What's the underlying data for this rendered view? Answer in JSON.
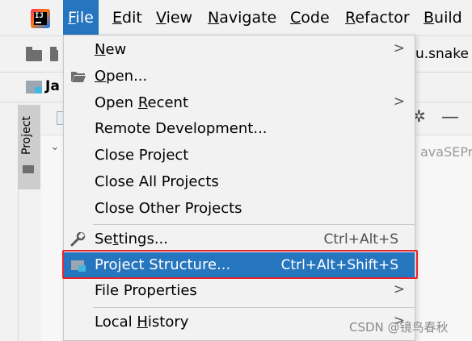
{
  "menubar": {
    "items": [
      {
        "pre": "",
        "mn": "F",
        "post": "ile"
      },
      {
        "pre": "",
        "mn": "E",
        "post": "dit"
      },
      {
        "pre": "",
        "mn": "V",
        "post": "iew"
      },
      {
        "pre": "",
        "mn": "N",
        "post": "avigate"
      },
      {
        "pre": "",
        "mn": "C",
        "post": "ode"
      },
      {
        "pre": "",
        "mn": "R",
        "post": "efactor"
      },
      {
        "pre": "",
        "mn": "B",
        "post": "uild"
      }
    ]
  },
  "toolbar": {
    "trailing_text": "u.snake"
  },
  "breadcrumb": {
    "text": "Ja"
  },
  "sidebar": {
    "project_tab": "Project"
  },
  "background": {
    "tree_text": "avaSEPr"
  },
  "file_menu": {
    "items": [
      {
        "pre": "",
        "mn": "N",
        "post": "ew",
        "arrow": ">"
      },
      {
        "pre": "",
        "mn": "O",
        "post": "pen..."
      },
      {
        "pre": "Open ",
        "mn": "R",
        "post": "ecent",
        "arrow": ">"
      },
      {
        "label": "Remote Development..."
      },
      {
        "label": "Close Project"
      },
      {
        "label": "Close All Projects"
      },
      {
        "label": "Close Other Projects"
      },
      {
        "pre": "Se",
        "mn": "t",
        "post": "tings...",
        "shortcut": "Ctrl+Alt+S"
      },
      {
        "label": "Project Structure...",
        "shortcut": "Ctrl+Alt+Shift+S"
      },
      {
        "label": "File Properties",
        "arrow": ">"
      },
      {
        "pre": "Local ",
        "mn": "H",
        "post": "istory",
        "arrow": ">"
      }
    ]
  },
  "watermark": "CSDN @镜鸟春秋",
  "colors": {
    "selection": "#2675bf",
    "highlight_border": "#e8232a",
    "menu_bg": "#f2f2f2"
  }
}
